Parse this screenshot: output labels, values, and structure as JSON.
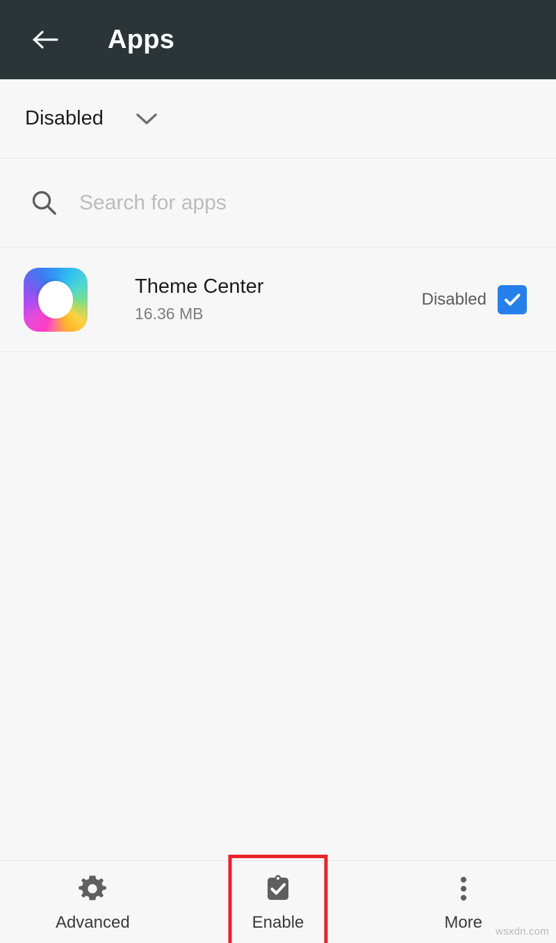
{
  "header": {
    "title": "Apps",
    "back_icon": "arrow-left-icon",
    "background_color": "#2b3538",
    "title_color": "#ffffff"
  },
  "filter": {
    "selected": "Disabled",
    "chevron_icon": "chevron-down-icon",
    "options": [
      "Disabled"
    ]
  },
  "search": {
    "icon": "search-icon",
    "placeholder": "Search for apps",
    "value": ""
  },
  "app_list": {
    "rows": [
      {
        "icon": "theme-center-app-icon",
        "name": "Theme Center",
        "size": "16.36 MB",
        "status": "Disabled",
        "checked": true,
        "check_color": "#2680eb"
      }
    ]
  },
  "bottom_bar": {
    "items": [
      {
        "label": "Advanced",
        "icon": "gear-icon",
        "highlighted": false
      },
      {
        "label": "Enable",
        "icon": "clipboard-check-icon",
        "highlighted": true
      },
      {
        "label": "More",
        "icon": "more-vertical-icon",
        "highlighted": false
      }
    ],
    "highlight_color": "#e8232a"
  },
  "watermark": {
    "text": "wsxdn.com"
  }
}
